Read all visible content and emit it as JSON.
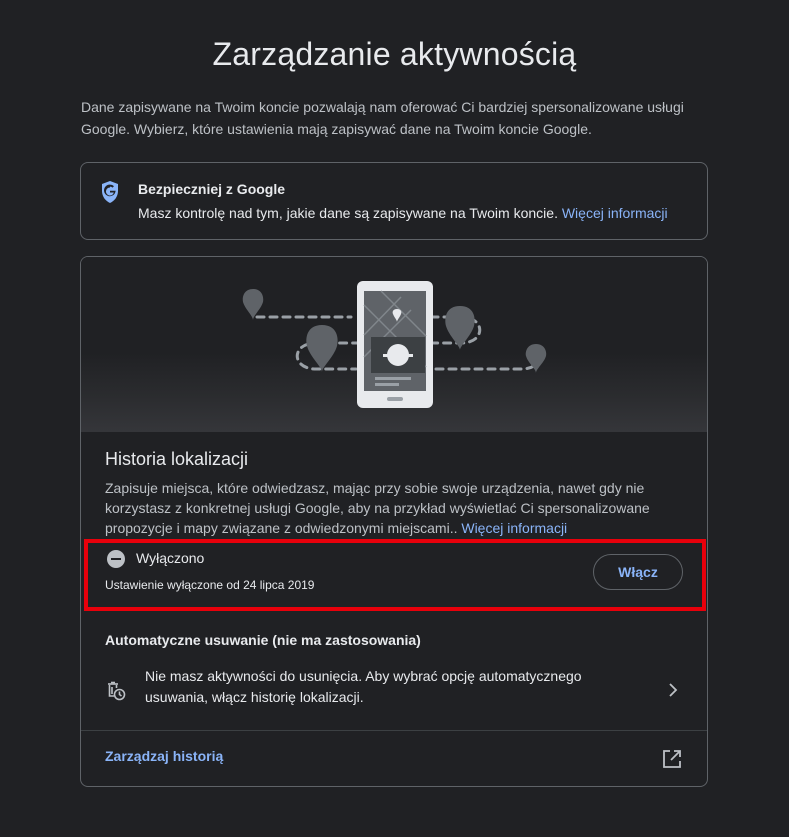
{
  "page": {
    "title": "Zarządzanie aktywnością",
    "intro": "Dane zapisywane na Twoim koncie pozwalają nam oferować Ci bardziej spersonalizowane usługi Google. Wybierz, które ustawienia mają zapisywać dane na Twoim koncie Google."
  },
  "safer": {
    "icon": "google-shield-icon",
    "title": "Bezpieczniej z Google",
    "text": "Masz kontrolę nad tym, jakie dane są zapisywane na Twoim koncie. ",
    "link": "Więcej informacji"
  },
  "location_history": {
    "title": "Historia lokalizacji",
    "description": "Zapisuje miejsca, które odwiedzasz, mając przy sobie swoje urządzenia, nawet gdy nie korzystasz z konkretnej usługi Google, aby na przykład wyświetlać Ci spersonalizowane propozycje i mapy związane z odwiedzonymi miejscami.. ",
    "description_link": "Więcej informacji",
    "status_icon": "minus-circle-icon",
    "status": "Wyłączono",
    "status_detail": "Ustawienie wyłączone od 24 lipca 2019",
    "enable_button": "Włącz"
  },
  "auto_delete": {
    "title": "Automatyczne usuwanie (nie ma zastosowania)",
    "icon": "auto-delete-icon",
    "text": "Nie masz aktywności do usunięcia. Aby wybrać opcję automatycznego usuwania, włącz historię lokalizacji.",
    "chevron": "chevron-right-icon"
  },
  "manage": {
    "label": "Zarządzaj historią",
    "icon": "open-in-new-icon"
  },
  "colors": {
    "background": "#202124",
    "link": "#8ab4f8",
    "highlight": "#e8000b",
    "shield": "#8ab4f8"
  }
}
